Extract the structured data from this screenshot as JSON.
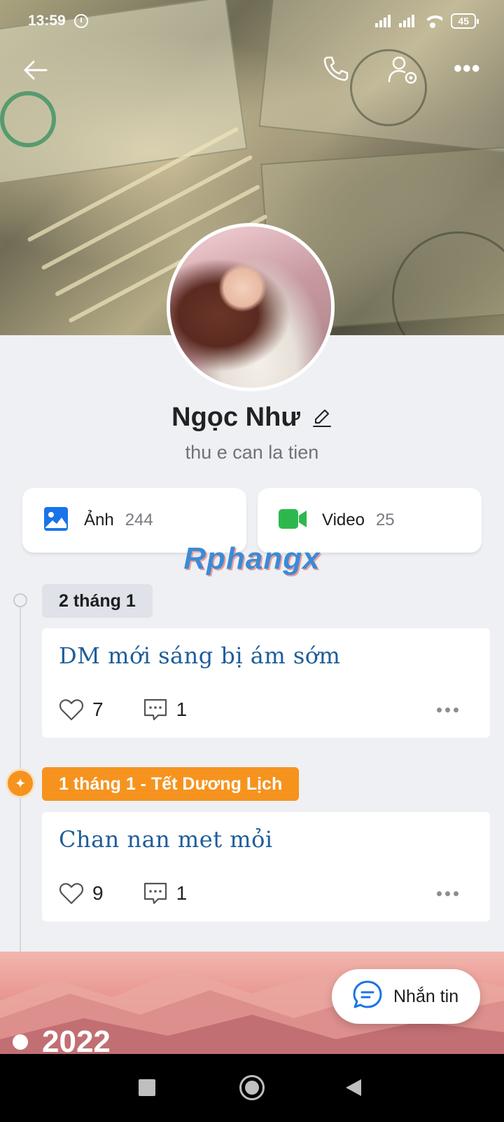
{
  "status_bar": {
    "time": "13:59",
    "battery": "45",
    "icons": [
      "alarm-icon",
      "signal-icon",
      "signal-icon",
      "wifi-icon",
      "battery-icon"
    ]
  },
  "header": {
    "icons": [
      "back-arrow-icon",
      "phone-icon",
      "user-settings-icon",
      "more-icon"
    ]
  },
  "profile": {
    "name": "Ngọc Như",
    "status": "thu e can la tien"
  },
  "media": {
    "photos_label": "Ảnh",
    "photos_count": "244",
    "videos_label": "Video",
    "videos_count": "25"
  },
  "watermark": "Rphangx",
  "timeline": [
    {
      "date": "2 tháng 1",
      "post_text": "DM mới sáng bị ám sớm",
      "likes": "7",
      "comments": "1"
    },
    {
      "date": "1 tháng 1 - Tết Dương Lịch",
      "post_text": "Chan nan met mỏi",
      "likes": "9",
      "comments": "1"
    }
  ],
  "year_banner": "2022",
  "message_button": "Nhắn tin",
  "colors": {
    "accent_blue": "#1a73e8",
    "video_green": "#2db84d",
    "holiday_orange": "#f6931e",
    "post_text_blue": "#1f5d9a"
  }
}
